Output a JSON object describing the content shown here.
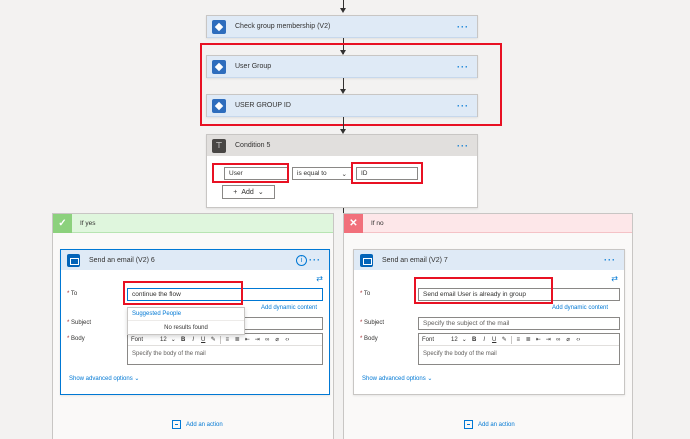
{
  "flow": {
    "steps": [
      {
        "title": "Check group membership (V2)"
      },
      {
        "title": "User Group"
      },
      {
        "title": "USER GROUP ID"
      }
    ],
    "condition": {
      "title": "Condition 5",
      "left_value": "User",
      "operator": "is equal to",
      "right_value": "ID",
      "add_label": "Add"
    }
  },
  "branches": {
    "yes": {
      "label": "If yes",
      "email": {
        "title": "Send an email (V2) 6",
        "to_label": "To",
        "to_value": "continue the flow",
        "add_dynamic": "Add dynamic content",
        "suggest_header": "Suggested People",
        "suggest_empty": "No results found",
        "subject_label": "Subject",
        "body_label": "Body",
        "font_label": "Font",
        "font_size": "12",
        "body_placeholder": "Specify the body of the mail",
        "show_advanced": "Show advanced options"
      },
      "add_action": "Add an action"
    },
    "no": {
      "label": "If no",
      "email": {
        "title": "Send an email (V2) 7",
        "to_label": "To",
        "to_value": "Send email User is already in group",
        "add_dynamic": "Add dynamic content",
        "subject_label": "Subject",
        "subject_placeholder": "Specify the subject of the mail",
        "body_label": "Body",
        "font_label": "Font",
        "font_size": "12",
        "body_placeholder": "Specify the body of the mail",
        "show_advanced": "Show advanced options"
      },
      "add_action": "Add an action"
    }
  },
  "colors": {
    "accent": "#0078d4",
    "highlight": "#e81123",
    "yes_green": "#8cd17d",
    "no_red": "#f1707b"
  }
}
